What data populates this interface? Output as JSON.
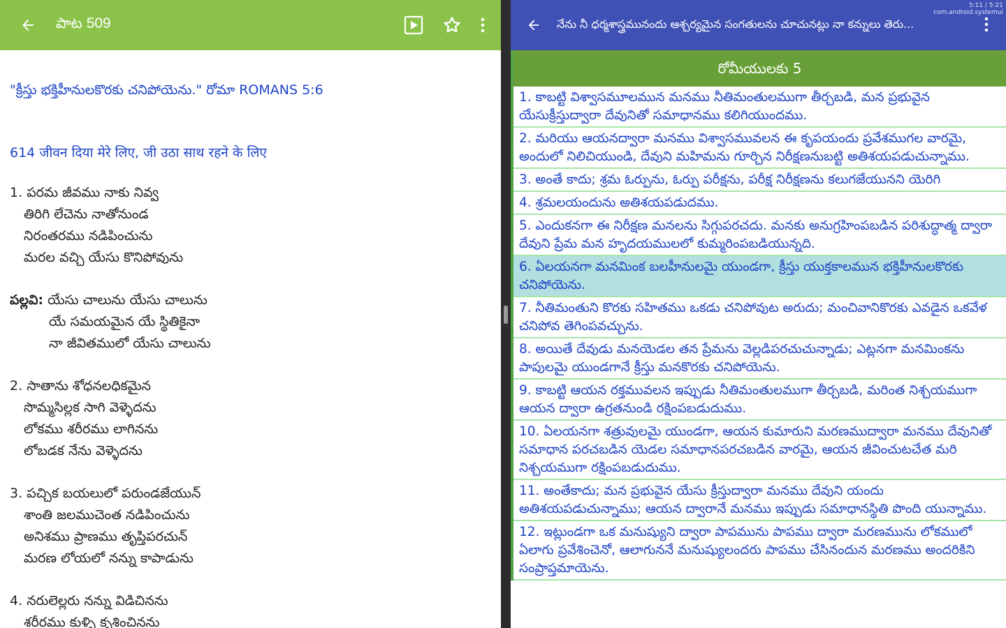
{
  "left": {
    "title": "పాట 509",
    "back_icon": "arrow-left-icon",
    "actions": [
      "play-icon",
      "star-icon",
      "more-vert-icon"
    ],
    "verse_ref": "\"క్రీస్తు భక్తిహీనులకొరకు చనిపోయెను.\" రోమా ROMANS 5:6",
    "hindi_line": "614 जीवन दिया मेरे लिए, जी उठा साथ रहने के लिए",
    "stanza1": {
      "num": "1.",
      "lines": [
        "పరమ జీవము నాకు నివ్వ",
        "తిరిగి లేచెను నాతోనుండ",
        "నిరంతరము నడిపించును",
        "మరల వచ్చి యేసు కొనిపోవును"
      ]
    },
    "chorus": {
      "label": "పల్లవి:",
      "lines": [
        "యేసు చాలును యేసు చాలును",
        "యే సమయమైన యే స్థితికైనా",
        "నా జీవితములో యేసు చాలును"
      ]
    },
    "stanza2": {
      "num": "2.",
      "lines": [
        "సాతాను శోధనలధికమైన",
        "సొమ్మసిల్లక సాగి వెళ్ళెదను",
        "లోకము శరీరము లాగినను",
        "లోబడక నేను వెళ్ళెదను"
      ]
    },
    "stanza3": {
      "num": "3.",
      "lines": [
        "పచ్చిక బయలులో పరుండజేయున్",
        "శాంతి జలముచెంత నడిపించును",
        "అనిశము ప్రాణము తృప్తిపరచున్",
        "మరణ లోయలో నన్ను కాపాడును"
      ]
    },
    "stanza4": {
      "num": "4.",
      "lines": [
        "నరులెల్లరు నన్ను విడిచినను",
        "శరీరము కుళ్ళి కృశించినను"
      ]
    }
  },
  "right": {
    "title": "నేను నీ ధర్మశాస్త్రమునందు ఆశ్చర్యమైన సంగతులను చూచునట్లు నా కన్నులు తెరు...",
    "status_time": "5:11 / 5:21",
    "status_pkg": "com.android.systemui",
    "chapter": "రోమీయులకు 5",
    "verses": [
      "1. కాబట్టి విశ్వాసమూలమున మనము నీతిమంతులముగా తీర్చబడి, మన ప్రభువైన యేసుక్రీస్తుద్వారా దేవునితో సమాధానము కలిగియుందము.",
      "2. మరియు ఆయనద్వారా మనము విశ్వాసమువలన ఈ కృపయందు ప్రవేశముగల వారమై, అందులో నిలిచియుండి, దేవుని మహిమను గూర్చిన నిరీక్షణనుబట్టి అతిశయపడుచున్నాము.",
      "3. అంతే కాదు; శ్రమ ఓర్పును, ఓర్పు పరీక్షను, పరీక్ష నిరీక్షణను కలుగజేయునని యెరిగి",
      "4. శ్రమలయందును అతిశయపడుదము.",
      "5. ఎందుకనగా ఈ నిరీక్షణ మనలను సిగ్గుపరచదు. మనకు అనుగ్రహింపబడిన పరిశుద్ధాత్మ ద్వారా దేవుని ప్రేమ మన హృదయములలో కుమ్మరింపబడియున్నది.",
      "6. ఏలయనగా మనమింక బలహీనులమై యుండగా, క్రీస్తు యుక్తకాలమున భక్తిహీనులకొరకు చనిపోయెను.",
      "7. నీతిమంతుని కొరకు సహితము ఒకడు చనిపోవుట అరుదు; మంచివానికొరకు ఎవడైన ఒకవేళ చనిపోవ తెగింపవచ్చును.",
      "8. అయితే దేవుడు మనయెడల తన ప్రేమను వెల్లడిపరచుచున్నాడు; ఎట్లనగా మనమింకను పాపులమై యుండగానే క్రీస్తు మనకొరకు చనిపోయెను.",
      "9. కాబట్టి ఆయన రక్తమువలన ఇప్పుడు నీతిమంతులముగా తీర్చబడి, మరింత నిశ్చయముగా ఆయన ద్వారా ఉగ్రతనుండి రక్షింపబడుదుము.",
      "10. ఏలయనగా శత్రువులమై యుండగా, ఆయన కుమారుని మరణముద్వారా మనము దేవునితో సమాధాన పరచబడిన యెడల సమాధానపరచబడిన వారమై, ఆయన జీవించుటచేత మరి నిశ్చయముగా రక్షింపబడుదుము.",
      "11. అంతేకాదు; మన ప్రభువైన యేసు క్రీస్తుద్వారా మనము దేవుని యందు అతిశయపడుచున్నాము; ఆయన ద్వారానే మనము ఇప్పుడు సమాధానస్థితి పొంది యున్నాము.",
      "12. ఇట్లుండగా ఒక మనుష్యుని ద్వారా పాపమును పాపము ద్వారా మరణమును లోకములో ఏలాగు ప్రవేశించెనో, ఆలాగుననే మనుష్యులందరు పాపము చేసినందున మరణము అందరికిని సంప్రాప్తమాయెను."
    ],
    "active_verse_index": 5,
    "colors": {
      "left_bar": "#8bc34a",
      "right_bar": "#3f51b5",
      "chapter_bar": "#689f38",
      "verse_text": "#1e44c8",
      "highlight": "#b2dfe0"
    }
  }
}
